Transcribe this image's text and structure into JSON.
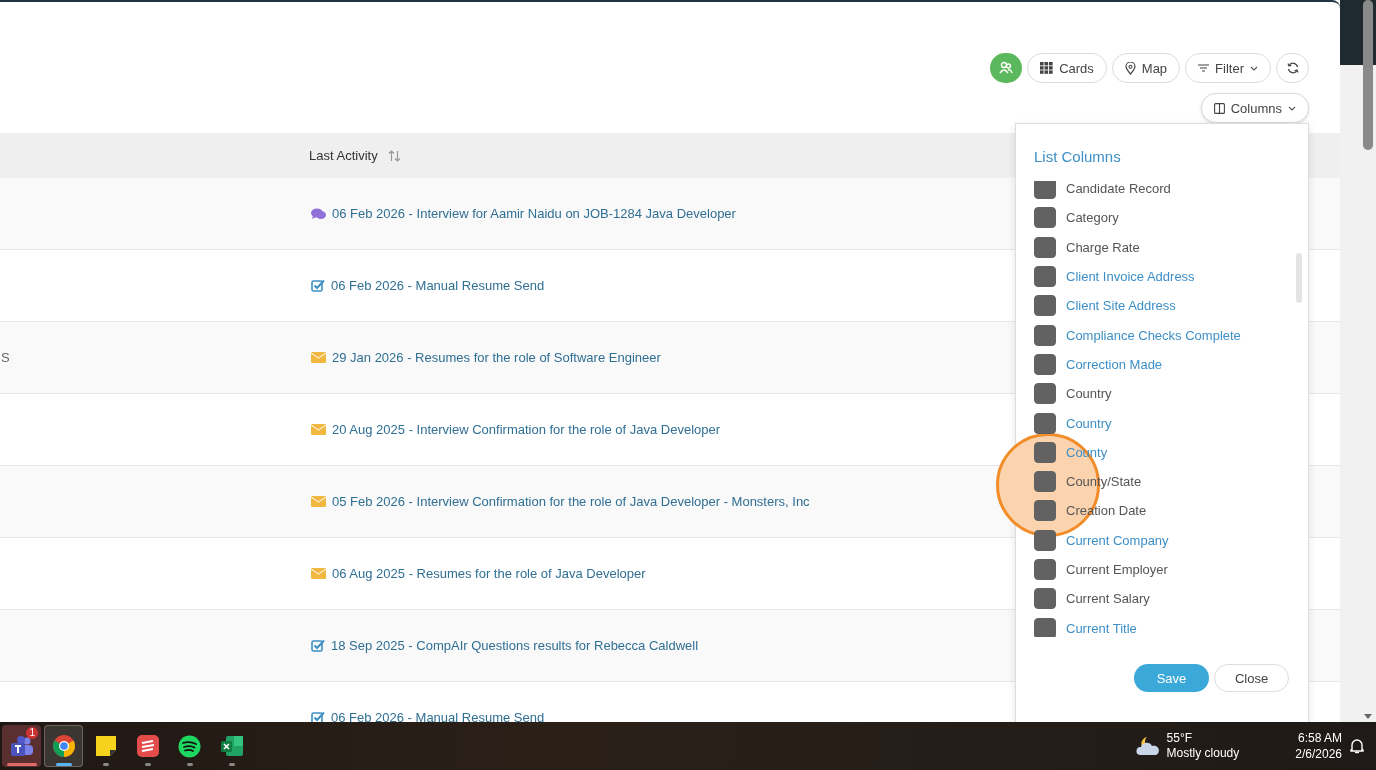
{
  "toolbar": {
    "buttons": [
      {
        "kind": "people"
      },
      {
        "kind": "cards",
        "label": "Cards"
      },
      {
        "kind": "map",
        "label": "Map"
      },
      {
        "kind": "filter",
        "label": "Filter"
      },
      {
        "kind": "refresh"
      }
    ]
  },
  "columns_button": {
    "label": "Columns"
  },
  "table": {
    "columns": [
      {
        "label": "Last Activity"
      }
    ],
    "rows": [
      {
        "activity": "06 Feb 2026 - Interview for Aamir Naidu on JOB-1284 Java Developer",
        "kind": "chat"
      },
      {
        "activity": "06 Feb 2026 - Manual Resume Send",
        "kind": "task"
      },
      {
        "column_1": "S",
        "activity": "29 Jan 2026 - Resumes for the role of Software Engineer",
        "kind": "email"
      },
      {
        "activity": "20 Aug 2025 - Interview Confirmation for the role of Java Developer",
        "kind": "email"
      },
      {
        "activity": "05 Feb 2026 - Interview Confirmation for the role of Java Developer - Monsters, Inc",
        "kind": "email"
      },
      {
        "activity": "06 Aug 2025 - Resumes for the role of Java Developer",
        "kind": "email"
      },
      {
        "activity": "18 Sep 2025 - CompAIr Questions results for Rebecca Caldwell",
        "kind": "task"
      },
      {
        "activity": "06 Feb 2026 - Manual Resume Send",
        "kind": "task"
      }
    ]
  },
  "popup": {
    "title": "List Columns",
    "items": [
      {
        "label": "Candidate Record",
        "color": "#555555",
        "checked": true
      },
      {
        "label": "Category",
        "color": "#555555",
        "checked": true
      },
      {
        "label": "Charge Rate",
        "color": "#555555",
        "checked": true
      },
      {
        "label": "Client Invoice Address",
        "color": "#3d8fc6",
        "checked": true
      },
      {
        "label": "Client Site Address",
        "color": "#3d8fc6",
        "checked": true
      },
      {
        "label": "Compliance Checks Complete",
        "color": "#3d8fc6",
        "checked": true
      },
      {
        "label": "Correction Made",
        "color": "#3d8fc6",
        "checked": true
      },
      {
        "label": "Country",
        "color": "#555555",
        "checked": true
      },
      {
        "label": "Country",
        "color": "#3d8fc6",
        "checked": true
      },
      {
        "label": "County",
        "color": "#3d8fc6",
        "checked": true
      },
      {
        "label": "County/State",
        "color": "#555555",
        "checked": true
      },
      {
        "label": "Creation Date",
        "color": "#555555",
        "checked": true
      },
      {
        "label": "Current Company",
        "color": "#3d8fc6",
        "checked": true
      },
      {
        "label": "Current Employer",
        "color": "#555555",
        "checked": true
      },
      {
        "label": "Current Salary",
        "color": "#555555",
        "checked": true
      },
      {
        "label": "Current Title",
        "color": "#3d8fc6",
        "checked": true
      }
    ],
    "buttons": [
      {
        "label": "Save",
        "kind": "primary"
      },
      {
        "label": "Close",
        "kind": "secondary"
      }
    ]
  },
  "click_highlight": true,
  "taskbar": {
    "apps": [
      {
        "kind": "teams",
        "badge": "1",
        "alert": true,
        "selected": false
      },
      {
        "kind": "chrome",
        "alert": false,
        "selected": true
      },
      {
        "kind": "notes",
        "alert": false,
        "selected": false
      },
      {
        "kind": "todo",
        "alert": false,
        "selected": false
      },
      {
        "kind": "spotify",
        "alert": false,
        "selected": false
      },
      {
        "kind": "excel",
        "alert": false,
        "selected": false
      }
    ],
    "weather": {
      "temperature": "55°F",
      "condition": "Mostly cloudy"
    },
    "clock": {
      "time": "6:58 AM",
      "date": "2/6/2026"
    }
  }
}
